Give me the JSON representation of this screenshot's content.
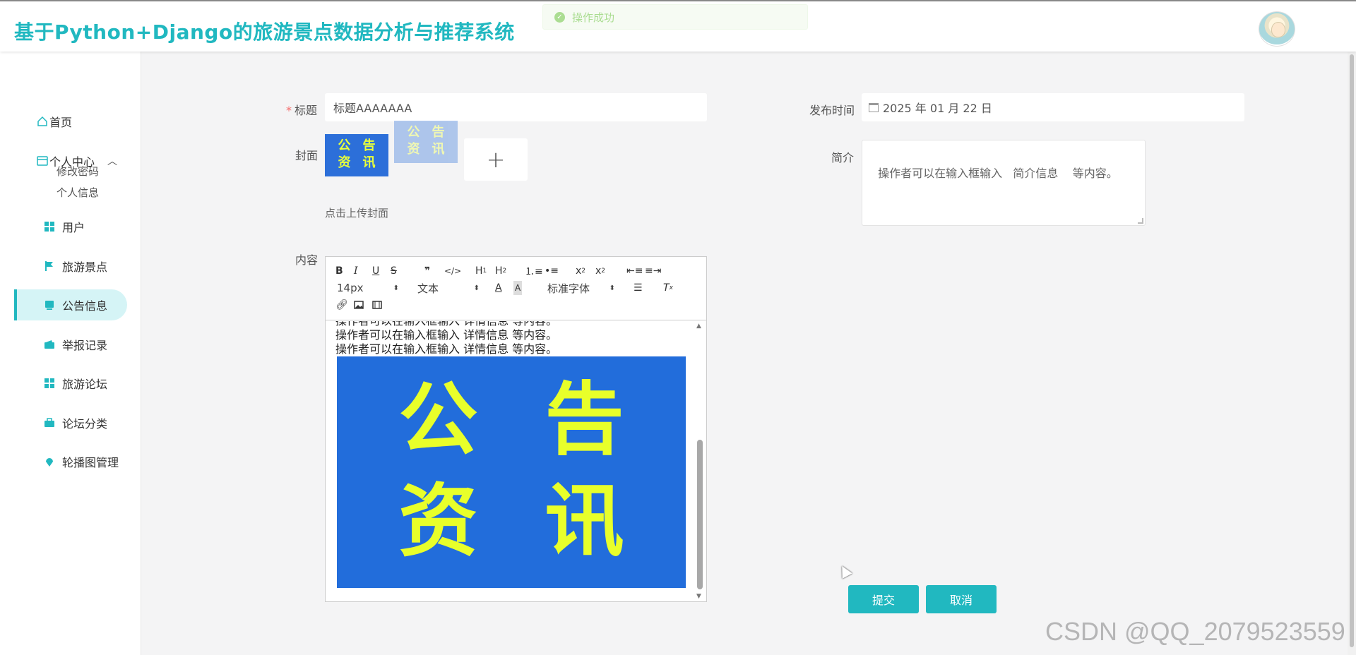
{
  "header": {
    "title": "基于Python+Django的旅游景点数据分析与推荐系统",
    "toast": "操作成功"
  },
  "sidebar": {
    "items": [
      {
        "label": "首页",
        "icon": "home-icon"
      },
      {
        "label": "个人中心",
        "icon": "card-icon",
        "expanded": true,
        "children": [
          {
            "label": "修改密码"
          },
          {
            "label": "个人信息"
          }
        ]
      },
      {
        "label": "用户",
        "icon": "grid-icon"
      },
      {
        "label": "旅游景点",
        "icon": "flag-icon"
      },
      {
        "label": "公告信息",
        "icon": "notice-icon",
        "active": true
      },
      {
        "label": "举报记录",
        "icon": "wallet-icon"
      },
      {
        "label": "旅游论坛",
        "icon": "grid-icon"
      },
      {
        "label": "论坛分类",
        "icon": "briefcase-icon"
      },
      {
        "label": "轮播图管理",
        "icon": "pin-icon"
      }
    ]
  },
  "form": {
    "title_label": "标题",
    "title_value": "标题AAAAAAA",
    "date_label": "发布时间",
    "date_value": "2025 年 01 月 22 日",
    "cover_label": "封面",
    "cover_text": [
      "公",
      "告",
      "资",
      "讯"
    ],
    "cover_hint": "点击上传封面",
    "intro_label": "简介",
    "intro_value": "操作者可以在输入框输入   简介信息    等内容。",
    "content_label": "内容",
    "submit_label": "提交",
    "cancel_label": "取消"
  },
  "editor": {
    "toolbar": {
      "font_size": "14px",
      "header": "文本",
      "font_family": "标准字体"
    },
    "lines": [
      "操作者可以在输入框输入  详情信息  等内容。",
      "操作者可以在输入框输入  详情信息  等内容。",
      "操作者可以在输入框输入  详情信息  等内容。"
    ],
    "image_text": [
      "公",
      "告",
      "资",
      "讯"
    ]
  },
  "watermark": "CSDN @QQ_2079523559",
  "colors": {
    "accent": "#21b8c0",
    "active_bg": "#d5f4f6",
    "banner_blue": "#226ddb",
    "banner_yellow": "#e8ff2a"
  }
}
